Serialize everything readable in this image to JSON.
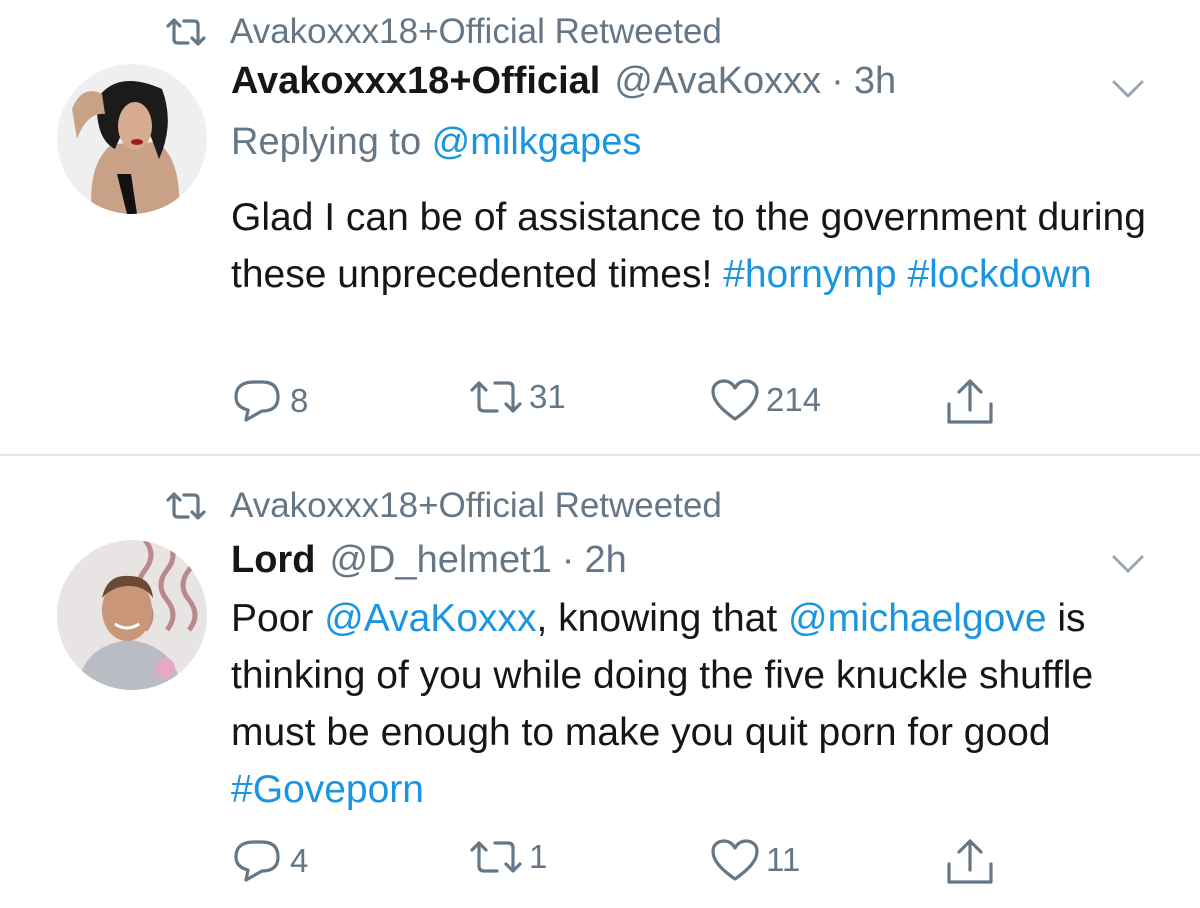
{
  "tweets": [
    {
      "retweeted_by": "Avakoxxx18+Official Retweeted",
      "author_name": "Avakoxxx18+Official",
      "handle": "@AvaKoxxx",
      "separator": "·",
      "time": "3h",
      "replying_prefix": "Replying to ",
      "replying_to": "@milkgapes",
      "text_parts": [
        "Glad I can be of assistance to the government during these unprecedented times! ",
        "#hornymp",
        " ",
        "#lockdown"
      ],
      "reply_count": "8",
      "retweet_count": "31",
      "like_count": "214",
      "avatar_icon": "avatar-woman-photo"
    },
    {
      "retweeted_by": "Avakoxxx18+Official Retweeted",
      "author_name": "Lord",
      "handle": "@D_helmet1",
      "separator": "·",
      "time": "2h",
      "text_parts": [
        "Poor ",
        "@AvaKoxxx",
        ", knowing that ",
        "@michaelgove",
        " is thinking of you while doing the five knuckle shuffle must be enough to make you quit porn for good ",
        "#Goveporn"
      ],
      "reply_count": "4",
      "retweet_count": "1",
      "like_count": "11",
      "avatar_icon": "avatar-man-photo"
    }
  ],
  "colors": {
    "link": "#1b95e0",
    "muted": "#657786",
    "text": "#14171a",
    "divider": "#e1e8ed"
  },
  "icons": [
    "retweet-icon",
    "reply-icon",
    "like-icon",
    "share-icon",
    "chevron-down-icon"
  ]
}
